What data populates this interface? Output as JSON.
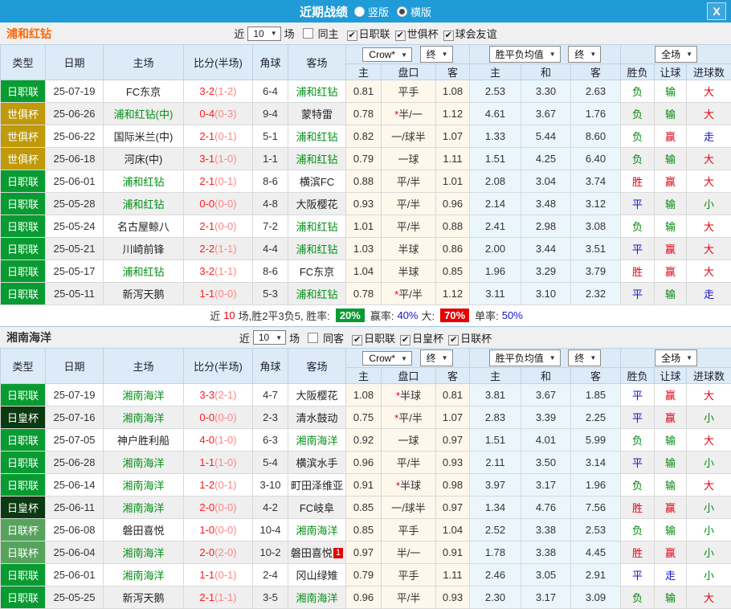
{
  "titlebar": {
    "title": "近期战绩",
    "radios": [
      {
        "label": "竖版",
        "selected": false
      },
      {
        "label": "横版",
        "selected": true
      }
    ],
    "close_label": "X"
  },
  "colors": {
    "titlebar_bg": "#1f9bd7",
    "type": {
      "日职联": "#089b31",
      "世俱杯": "#c09a0a",
      "日皇杯": "#0c3a10",
      "日联杯": "#57a35e"
    },
    "result": {
      "胜": "#e60013",
      "平": "#1414cc",
      "负": "#028a0f",
      "赢": "#e60013",
      "输": "#028a0f",
      "走": "#1414cc",
      "大": "#e60013",
      "小": "#028a0f"
    },
    "self_team": "#029114",
    "opponent_team": "#222222"
  },
  "table_header": {
    "left": [
      "类型",
      "日期",
      "主场",
      "比分(半场)",
      "角球",
      "客场"
    ],
    "crow_dd": "Crow*",
    "crow_final_dd": "终",
    "avg_dd": "胜平负均值",
    "avg_final_dd": "终",
    "scope_dd": "全场",
    "sub": [
      "主",
      "盘口",
      "客",
      "主",
      "和",
      "客",
      "胜负",
      "让球",
      "进球数"
    ]
  },
  "sections": [
    {
      "team": "浦和红钻",
      "team_color": "#ff6600",
      "filter": {
        "near": "近",
        "count": "10",
        "games": "场",
        "same_label": "同主",
        "same_checked": false,
        "leagues": [
          {
            "label": "日职联",
            "checked": true
          },
          {
            "label": "世俱杯",
            "checked": true
          },
          {
            "label": "球会友谊",
            "checked": true
          }
        ]
      },
      "rows": [
        {
          "type": "日职联",
          "date": "25-07-19",
          "home": "FC东京",
          "home_self": false,
          "score": "3-2",
          "half": "(1-2)",
          "corners": "6-4",
          "away": "浦和红钻",
          "away_self": true,
          "odds": [
            "0.81",
            "平手",
            "1.08"
          ],
          "star": false,
          "avg": [
            "2.53",
            "3.30",
            "2.63"
          ],
          "results": [
            "负",
            "输",
            "大"
          ]
        },
        {
          "type": "世俱杯",
          "date": "25-06-26",
          "home": "浦和红钻(中)",
          "home_self": true,
          "score": "0-4",
          "half": "(0-3)",
          "corners": "9-4",
          "away": "蒙特雷",
          "away_self": false,
          "odds": [
            "0.78",
            "半/一",
            "1.12"
          ],
          "star": true,
          "avg": [
            "4.61",
            "3.67",
            "1.76"
          ],
          "results": [
            "负",
            "输",
            "大"
          ]
        },
        {
          "type": "世俱杯",
          "date": "25-06-22",
          "home": "国际米兰(中)",
          "home_self": false,
          "score": "2-1",
          "half": "(0-1)",
          "corners": "5-1",
          "away": "浦和红钻",
          "away_self": true,
          "odds": [
            "0.82",
            "一/球半",
            "1.07"
          ],
          "star": false,
          "avg": [
            "1.33",
            "5.44",
            "8.60"
          ],
          "results": [
            "负",
            "赢",
            "走"
          ]
        },
        {
          "type": "世俱杯",
          "date": "25-06-18",
          "home": "河床(中)",
          "home_self": false,
          "score": "3-1",
          "half": "(1-0)",
          "corners": "1-1",
          "away": "浦和红钻",
          "away_self": true,
          "odds": [
            "0.79",
            "一球",
            "1.11"
          ],
          "star": false,
          "avg": [
            "1.51",
            "4.25",
            "6.40"
          ],
          "results": [
            "负",
            "输",
            "大"
          ]
        },
        {
          "type": "日职联",
          "date": "25-06-01",
          "home": "浦和红钻",
          "home_self": true,
          "score": "2-1",
          "half": "(0-1)",
          "corners": "8-6",
          "away": "横滨FC",
          "away_self": false,
          "odds": [
            "0.88",
            "平/半",
            "1.01"
          ],
          "star": false,
          "avg": [
            "2.08",
            "3.04",
            "3.74"
          ],
          "results": [
            "胜",
            "赢",
            "大"
          ]
        },
        {
          "type": "日职联",
          "date": "25-05-28",
          "home": "浦和红钻",
          "home_self": true,
          "score": "0-0",
          "half": "(0-0)",
          "corners": "4-8",
          "away": "大阪樱花",
          "away_self": false,
          "odds": [
            "0.93",
            "平/半",
            "0.96"
          ],
          "star": false,
          "avg": [
            "2.14",
            "3.48",
            "3.12"
          ],
          "results": [
            "平",
            "输",
            "小"
          ]
        },
        {
          "type": "日职联",
          "date": "25-05-24",
          "home": "名古屋鲸八",
          "home_self": false,
          "score": "2-1",
          "half": "(0-0)",
          "corners": "7-2",
          "away": "浦和红钻",
          "away_self": true,
          "odds": [
            "1.01",
            "平/半",
            "0.88"
          ],
          "star": false,
          "avg": [
            "2.41",
            "2.98",
            "3.08"
          ],
          "results": [
            "负",
            "输",
            "大"
          ]
        },
        {
          "type": "日职联",
          "date": "25-05-21",
          "home": "川崎前锋",
          "home_self": false,
          "score": "2-2",
          "half": "(1-1)",
          "corners": "4-4",
          "away": "浦和红钻",
          "away_self": true,
          "odds": [
            "1.03",
            "半球",
            "0.86"
          ],
          "star": false,
          "avg": [
            "2.00",
            "3.44",
            "3.51"
          ],
          "results": [
            "平",
            "赢",
            "大"
          ]
        },
        {
          "type": "日职联",
          "date": "25-05-17",
          "home": "浦和红钻",
          "home_self": true,
          "score": "3-2",
          "half": "(1-1)",
          "corners": "8-6",
          "away": "FC东京",
          "away_self": false,
          "odds": [
            "1.04",
            "半球",
            "0.85"
          ],
          "star": false,
          "avg": [
            "1.96",
            "3.29",
            "3.79"
          ],
          "results": [
            "胜",
            "赢",
            "大"
          ]
        },
        {
          "type": "日职联",
          "date": "25-05-11",
          "home": "新泻天鹅",
          "home_self": false,
          "score": "1-1",
          "half": "(0-0)",
          "corners": "5-3",
          "away": "浦和红钻",
          "away_self": true,
          "odds": [
            "0.78",
            "平/半",
            "1.12"
          ],
          "star": true,
          "avg": [
            "3.11",
            "3.10",
            "2.32"
          ],
          "results": [
            "平",
            "输",
            "走"
          ]
        }
      ],
      "summary": {
        "seg1": "近",
        "seg2": "10",
        "seg3": "场,胜2平3负5, 胜率:",
        "win_rate": "20%",
        "seg4": "赢率:",
        "hcap_rate": "40%",
        "seg5": "大:",
        "big_rate": "70%",
        "seg6": "单率:",
        "single_rate": "50%"
      }
    },
    {
      "team": "湘南海洋",
      "team_color": "#333333",
      "filter": {
        "near": "近",
        "count": "10",
        "games": "场",
        "same_label": "同客",
        "same_checked": false,
        "leagues": [
          {
            "label": "日职联",
            "checked": true
          },
          {
            "label": "日皇杯",
            "checked": true
          },
          {
            "label": "日联杯",
            "checked": true
          }
        ]
      },
      "rows": [
        {
          "type": "日职联",
          "date": "25-07-19",
          "home": "湘南海洋",
          "home_self": true,
          "score": "3-3",
          "half": "(2-1)",
          "corners": "4-7",
          "away": "大阪樱花",
          "away_self": false,
          "odds": [
            "1.08",
            "半球",
            "0.81"
          ],
          "star": true,
          "avg": [
            "3.81",
            "3.67",
            "1.85"
          ],
          "results": [
            "平",
            "赢",
            "大"
          ]
        },
        {
          "type": "日皇杯",
          "date": "25-07-16",
          "home": "湘南海洋",
          "home_self": true,
          "score": "0-0",
          "half": "(0-0)",
          "corners": "2-3",
          "away": "清水鼓动",
          "away_self": false,
          "odds": [
            "0.75",
            "平/半",
            "1.07"
          ],
          "star": true,
          "avg": [
            "2.83",
            "3.39",
            "2.25"
          ],
          "results": [
            "平",
            "赢",
            "小"
          ]
        },
        {
          "type": "日职联",
          "date": "25-07-05",
          "home": "神户胜利船",
          "home_self": false,
          "score": "4-0",
          "half": "(1-0)",
          "corners": "6-3",
          "away": "湘南海洋",
          "away_self": true,
          "odds": [
            "0.92",
            "一球",
            "0.97"
          ],
          "star": false,
          "avg": [
            "1.51",
            "4.01",
            "5.99"
          ],
          "results": [
            "负",
            "输",
            "大"
          ]
        },
        {
          "type": "日职联",
          "date": "25-06-28",
          "home": "湘南海洋",
          "home_self": true,
          "score": "1-1",
          "half": "(1-0)",
          "corners": "5-4",
          "away": "横滨水手",
          "away_self": false,
          "odds": [
            "0.96",
            "平/半",
            "0.93"
          ],
          "star": false,
          "avg": [
            "2.11",
            "3.50",
            "3.14"
          ],
          "results": [
            "平",
            "输",
            "小"
          ]
        },
        {
          "type": "日职联",
          "date": "25-06-14",
          "home": "湘南海洋",
          "home_self": true,
          "score": "1-2",
          "half": "(0-1)",
          "corners": "3-10",
          "away": "町田泽维亚",
          "away_self": false,
          "odds": [
            "0.91",
            "半球",
            "0.98"
          ],
          "star": true,
          "avg": [
            "3.97",
            "3.17",
            "1.96"
          ],
          "results": [
            "负",
            "输",
            "大"
          ]
        },
        {
          "type": "日皇杯",
          "date": "25-06-11",
          "home": "湘南海洋",
          "home_self": true,
          "score": "2-0",
          "half": "(0-0)",
          "corners": "4-2",
          "away": "FC岐阜",
          "away_self": false,
          "odds": [
            "0.85",
            "一/球半",
            "0.97"
          ],
          "star": false,
          "avg": [
            "1.34",
            "4.76",
            "7.56"
          ],
          "results": [
            "胜",
            "赢",
            "小"
          ]
        },
        {
          "type": "日联杯",
          "date": "25-06-08",
          "home": "磐田喜悦",
          "home_self": false,
          "score": "1-0",
          "half": "(0-0)",
          "corners": "10-4",
          "away": "湘南海洋",
          "away_self": true,
          "odds": [
            "0.85",
            "平手",
            "1.04"
          ],
          "star": false,
          "avg": [
            "2.52",
            "3.38",
            "2.53"
          ],
          "results": [
            "负",
            "输",
            "小"
          ]
        },
        {
          "type": "日联杯",
          "date": "25-06-04",
          "home": "湘南海洋",
          "home_self": true,
          "score": "2-0",
          "half": "(2-0)",
          "corners": "10-2",
          "away": "磐田喜悦",
          "away_self": false,
          "away_badge": "1",
          "odds": [
            "0.97",
            "半/一",
            "0.91"
          ],
          "star": false,
          "avg": [
            "1.78",
            "3.38",
            "4.45"
          ],
          "results": [
            "胜",
            "赢",
            "小"
          ]
        },
        {
          "type": "日职联",
          "date": "25-06-01",
          "home": "湘南海洋",
          "home_self": true,
          "score": "1-1",
          "half": "(0-1)",
          "corners": "2-4",
          "away": "冈山绿雉",
          "away_self": false,
          "odds": [
            "0.79",
            "平手",
            "1.11"
          ],
          "star": false,
          "avg": [
            "2.46",
            "3.05",
            "2.91"
          ],
          "results": [
            "平",
            "走",
            "小"
          ]
        },
        {
          "type": "日职联",
          "date": "25-05-25",
          "home": "新泻天鹅",
          "home_self": false,
          "score": "2-1",
          "half": "(1-1)",
          "corners": "3-5",
          "away": "湘南海洋",
          "away_self": true,
          "odds": [
            "0.96",
            "平/半",
            "0.93"
          ],
          "star": false,
          "avg": [
            "2.30",
            "3.17",
            "3.09"
          ],
          "results": [
            "负",
            "输",
            "大"
          ]
        }
      ],
      "summary": null
    }
  ]
}
